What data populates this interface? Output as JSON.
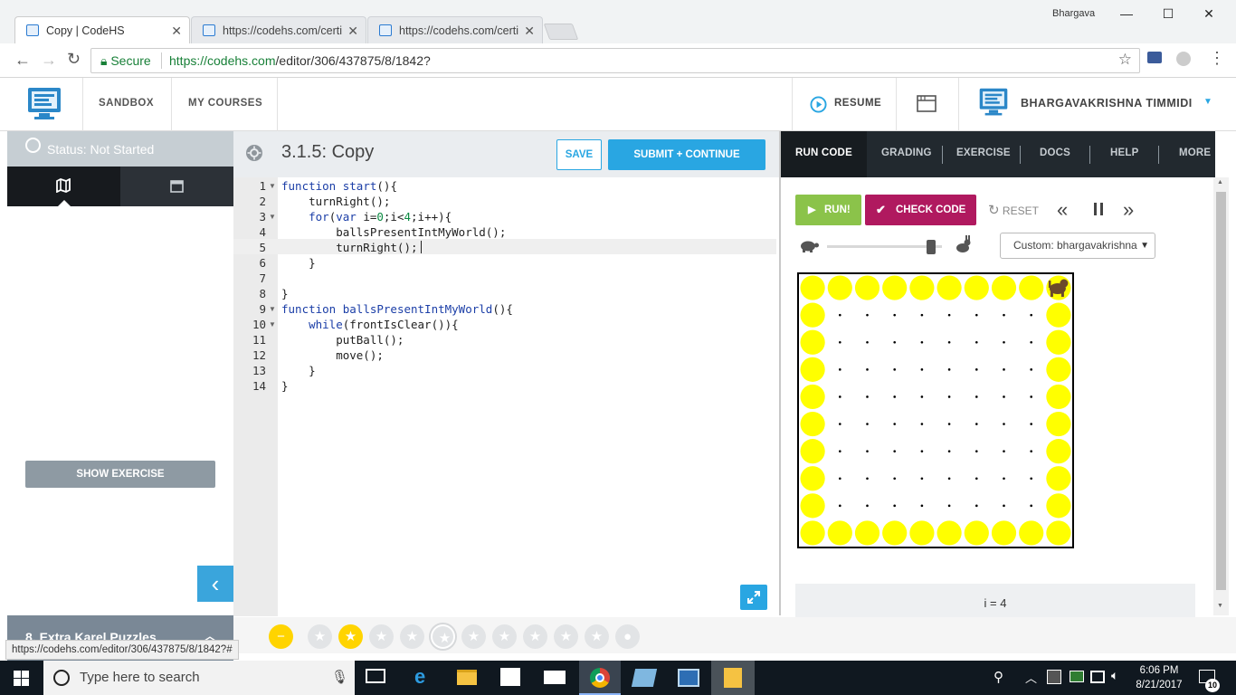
{
  "browser": {
    "tabs": [
      {
        "title": "Copy | CodeHS",
        "active": true
      },
      {
        "title": "https://codehs.com/certi",
        "active": false
      },
      {
        "title": "https://codehs.com/certi",
        "active": false
      }
    ],
    "profile_name": "Bhargava",
    "secure_label": "Secure",
    "url_host": "https://codehs.com",
    "url_path": "/editor/306/437875/8/1842?",
    "status_url": "https://codehs.com/editor/306/437875/8/1842?#"
  },
  "header": {
    "nav": [
      "SANDBOX",
      "MY COURSES"
    ],
    "resume": "RESUME",
    "user_name": "BHARGAVAKRISHNA TIMMIDI"
  },
  "left_panel": {
    "status": "Status: Not Started",
    "show_exercise": "SHOW EXERCISE",
    "lesson_footer": "8. Extra Karel Puzzles"
  },
  "editor": {
    "title": "3.1.5: Copy",
    "save": "SAVE",
    "submit": "SUBMIT + CONTINUE",
    "line_numbers": [
      "1",
      "2",
      "3",
      "4",
      "5",
      "6",
      "7",
      "8",
      "9",
      "10",
      "11",
      "12",
      "13",
      "14"
    ],
    "code": [
      "function start(){",
      "    turnRight();",
      "    for(var i=0;i<4;i++){",
      "        ballsPresentIntMyWorld();",
      "        turnRight();",
      "    }",
      "",
      "}",
      "function ballsPresentIntMyWorld(){",
      "    while(frontIsClear()){",
      "        putBall();",
      "        move();",
      "    }",
      "}"
    ]
  },
  "right_panel": {
    "tabs": [
      "RUN CODE",
      "GRADING",
      "EXERCISE",
      "DOCS",
      "HELP",
      "MORE"
    ],
    "run": "RUN!",
    "check_code": "CHECK CODE",
    "reset": "RESET",
    "world_select": "Custom: bhargavakrishna",
    "variable_readout": "i = 4",
    "world": {
      "cols": 10,
      "rows": 10,
      "ball_color": "#ffff00"
    }
  },
  "taskbar": {
    "search_placeholder": "Type here to search",
    "time": "6:06 PM",
    "date": "8/21/2017",
    "notifications": "10"
  },
  "colors": {
    "accent_blue": "#29a6e2",
    "run_green": "#8bc34a",
    "check_magenta": "#b0195f",
    "dark_nav": "#22292f"
  }
}
